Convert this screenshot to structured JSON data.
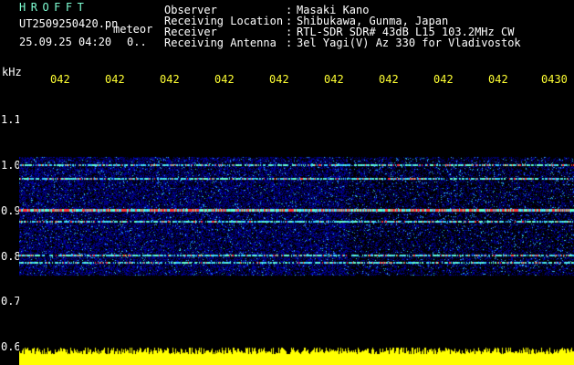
{
  "header": {
    "app_title": "HROFFT",
    "file_name": "UT2509250420.pn",
    "mode": "meteor",
    "date_time": "25.09.25 04:20",
    "count": "0..",
    "info": [
      {
        "label": "Observer",
        "value": "Masaki Kano"
      },
      {
        "label": "Receiving Location",
        "value": "Shibukawa, Gunma, Japan"
      },
      {
        "label": "Receiver",
        "value": "RTL-SDR SDR# 43dB L15 103.2MHz CW"
      },
      {
        "label": "Receiving Antenna",
        "value": "3el Yagi(V) Az 330 for Vladivostok"
      }
    ]
  },
  "axis": {
    "unit": "kHz",
    "time_ticks": [
      "042",
      "042",
      "042",
      "042",
      "042",
      "042",
      "042",
      "042",
      "042",
      "0430"
    ],
    "freq_ticks": [
      "1.1",
      "1.0",
      "0.9",
      "0.8",
      "0.7",
      "0.6"
    ]
  },
  "colors": {
    "background": "#000000",
    "spectrum_low": "#0000aa",
    "spectrum_mid": "#33ccff",
    "spectrum_high": "#ff3333",
    "amplitude_bar": "#ffff00",
    "tick_label": "#ffff33"
  },
  "chart_data": {
    "type": "heatmap",
    "title": "",
    "xlabel": "",
    "ylabel": "kHz",
    "ylim": [
      0.6,
      1.15
    ],
    "carriers_khz": [
      1.0,
      0.97,
      0.9,
      0.875,
      0.8,
      0.785
    ],
    "strongest_carrier_khz": 0.9
  }
}
